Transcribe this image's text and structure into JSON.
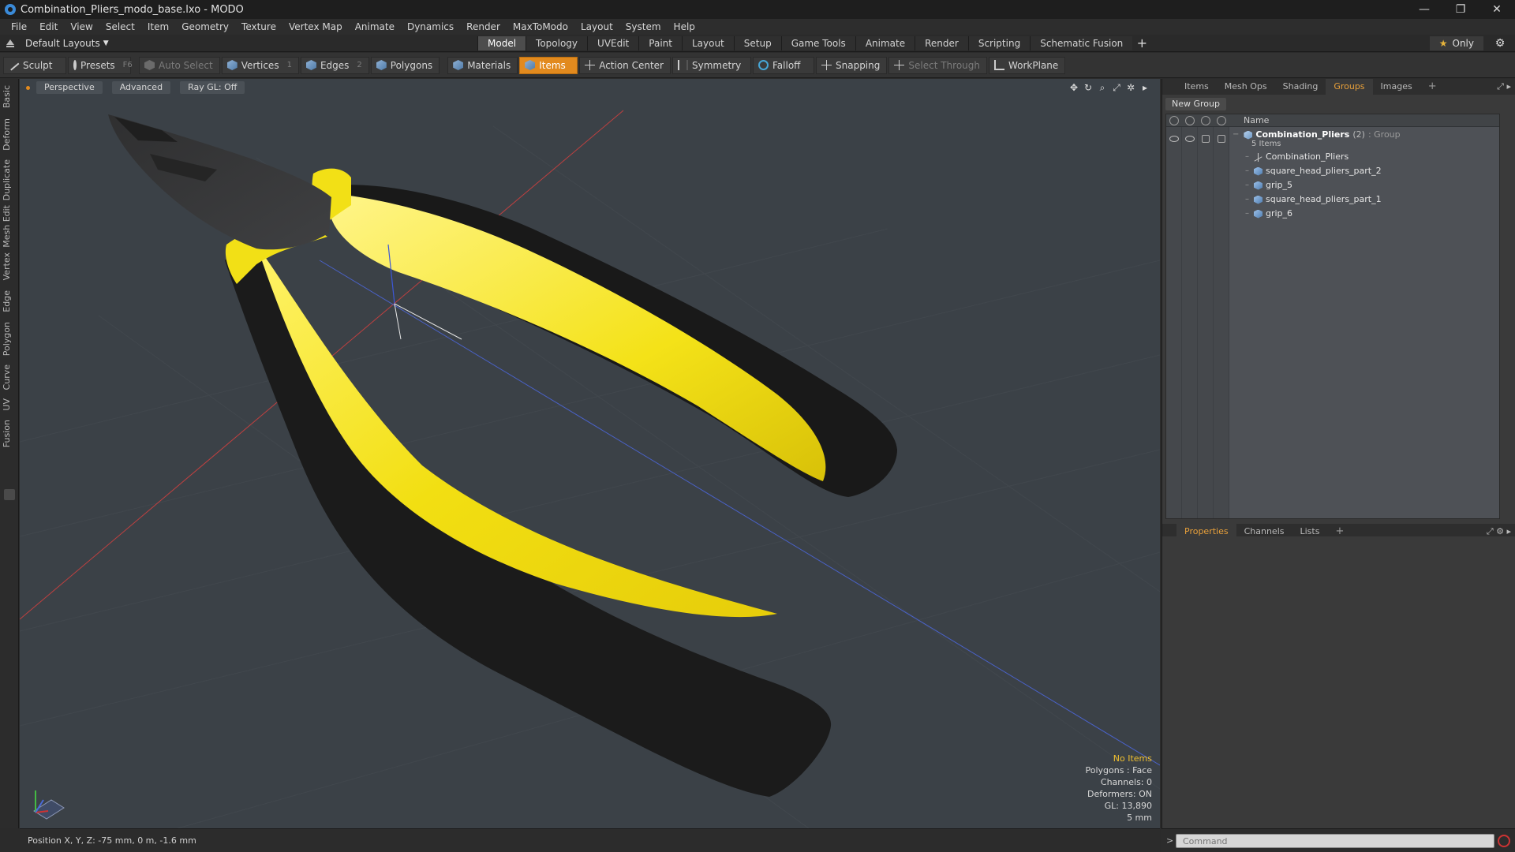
{
  "window": {
    "title": "Combination_Pliers_modo_base.lxo - MODO",
    "controls": [
      "—",
      "❐",
      "✕"
    ]
  },
  "menu": [
    "File",
    "Edit",
    "View",
    "Select",
    "Item",
    "Geometry",
    "Texture",
    "Vertex Map",
    "Animate",
    "Dynamics",
    "Render",
    "MaxToModo",
    "Layout",
    "System",
    "Help"
  ],
  "layout_selector": "Default Layouts",
  "mode_tabs": [
    "Model",
    "Topology",
    "UVEdit",
    "Paint",
    "Layout",
    "Setup",
    "Game Tools",
    "Animate",
    "Render",
    "Scripting",
    "Schematic Fusion"
  ],
  "mode_tab_active": "Model",
  "only_label": "Only",
  "toolbar": {
    "sculpt": "Sculpt",
    "presets": "Presets",
    "presets_key": "F6",
    "auto_select": "Auto Select",
    "vertices": "Vertices",
    "vertices_num": "1",
    "edges": "Edges",
    "edges_num": "2",
    "polygons": "Polygons",
    "materials": "Materials",
    "items": "Items",
    "action_center": "Action Center",
    "symmetry": "Symmetry",
    "falloff": "Falloff",
    "snapping": "Snapping",
    "select_through": "Select Through",
    "workplane": "WorkPlane"
  },
  "left_tabs": [
    "Basic",
    "Deform",
    "Duplicate",
    "Mesh Edit",
    "Vertex",
    "Edge",
    "Polygon",
    "Curve",
    "UV",
    "Fusion"
  ],
  "viewport": {
    "view": "Perspective",
    "shading": "Advanced",
    "raygl": "Ray GL: Off",
    "stats": {
      "selection": "No Items",
      "polygons": "Polygons : Face",
      "channels": "Channels: 0",
      "deformers": "Deformers: ON",
      "gl": "GL: 13,890",
      "unit": "5 mm"
    }
  },
  "status": {
    "position": "Position X, Y, Z:  -75 mm, 0 m, -1.6 mm"
  },
  "right_panel": {
    "top_tabs": [
      "Items",
      "Mesh Ops",
      "Shading",
      "Groups",
      "Images"
    ],
    "top_tab_active": "Groups",
    "new_group": "New Group",
    "column_name": "Name",
    "group": {
      "name": "Combination_Pliers",
      "count": "(2)",
      "type": ": Group",
      "items_label": "5 Items"
    },
    "items": [
      {
        "name": "Combination_Pliers",
        "icon": "locator-icon"
      },
      {
        "name": "square_head_pliers_part_2",
        "icon": "mesh-icon"
      },
      {
        "name": "grip_5",
        "icon": "mesh-icon"
      },
      {
        "name": "square_head_pliers_part_1",
        "icon": "mesh-icon"
      },
      {
        "name": "grip_6",
        "icon": "mesh-icon"
      }
    ],
    "bottom_tabs": [
      "Properties",
      "Channels",
      "Lists"
    ],
    "bottom_tab_active": "Properties",
    "command_placeholder": "Command"
  },
  "colors": {
    "accent": "#e28a1e",
    "grip_yellow": "#f3e21c",
    "grip_black": "#1a1a1a",
    "viewport_bg": "#3b4147"
  }
}
